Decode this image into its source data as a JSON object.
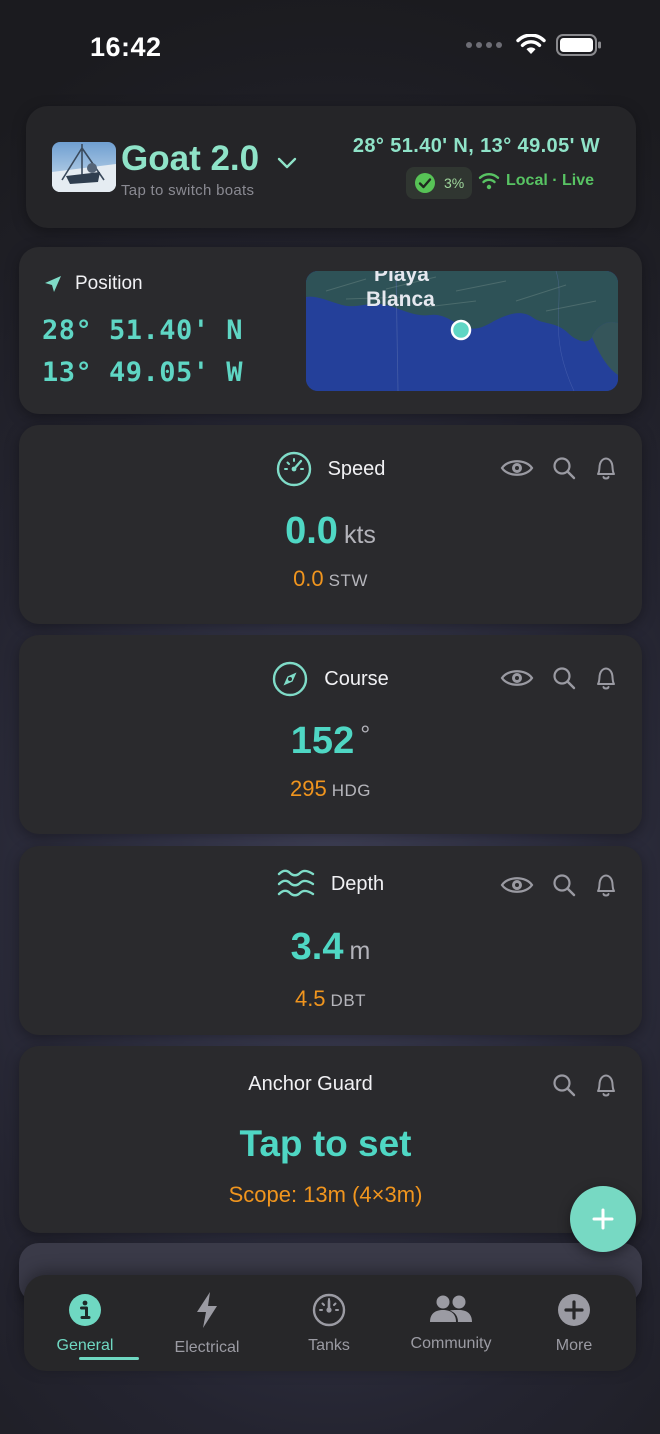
{
  "status_bar": {
    "time": "16:42"
  },
  "boat": {
    "name": "Goat 2.0",
    "subtitle": "Tap to switch boats",
    "coords": "28° 51.40' N, 13° 49.05' W",
    "battery": "3%",
    "connection": "Local · Live"
  },
  "position": {
    "label": "Position",
    "lat": "28° 51.40' N",
    "lon": "13° 49.05' W",
    "map_labels": [
      "Playa",
      "Blanca"
    ]
  },
  "speed": {
    "label": "Speed",
    "value": "0.0",
    "unit": "kts",
    "sub_value": "0.0",
    "sub_unit": "STW"
  },
  "course": {
    "label": "Course",
    "value": "152",
    "unit": "°",
    "sub_value": "295",
    "sub_unit": "HDG"
  },
  "depth": {
    "label": "Depth",
    "value": "3.4",
    "unit": "m",
    "sub_value": "4.5",
    "sub_unit": "DBT"
  },
  "anchor": {
    "label": "Anchor Guard",
    "main": "Tap to set",
    "scope": "Scope: 13m (4×3m)"
  },
  "tabs": [
    {
      "label": "General",
      "icon": "info-icon",
      "active": true
    },
    {
      "label": "Electrical",
      "icon": "bolt-icon",
      "active": false
    },
    {
      "label": "Tanks",
      "icon": "gauge-icon",
      "active": false
    },
    {
      "label": "Community",
      "icon": "people-icon",
      "active": false
    },
    {
      "label": "More",
      "icon": "plus-circle-icon",
      "active": false
    }
  ],
  "colors": {
    "accent": "#4fd7c4",
    "secondary": "#f0951e",
    "live": "#58c363"
  }
}
